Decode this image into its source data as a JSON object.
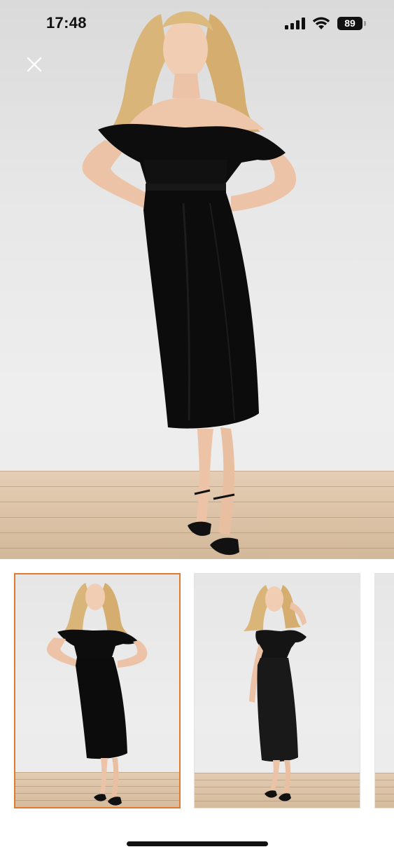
{
  "status_bar": {
    "time": "17:48",
    "battery_level": "89",
    "icons": [
      "cellular-signal-icon",
      "wifi-icon",
      "battery-icon"
    ]
  },
  "viewer": {
    "close_icon": "close-icon",
    "selected_thumbnail_index": 0,
    "thumbnail_count_visible": 3
  },
  "colors": {
    "selected_border": "#e07a2e",
    "dress": "#0d0d0d",
    "background": "#ffffff"
  }
}
